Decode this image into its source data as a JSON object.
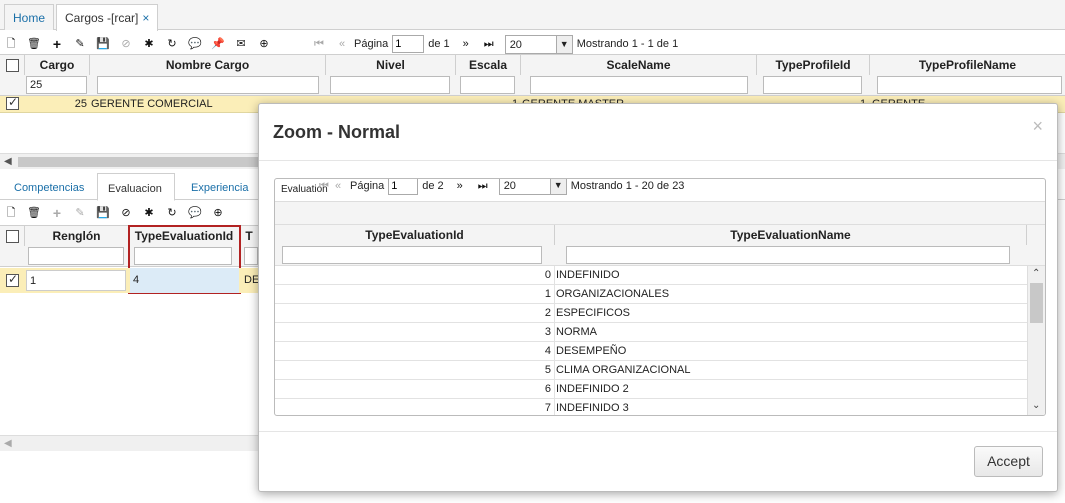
{
  "tabs": [
    {
      "label": "Home"
    },
    {
      "label": "Cargos -[rcar]",
      "close": "×"
    }
  ],
  "top_pager": {
    "page_label": "Página",
    "page_value": "1",
    "of_label": "de 1",
    "page_size": "20",
    "showing": "Mostrando 1 - 1 de 1"
  },
  "top_grid": {
    "columns": [
      "Cargo",
      "Nombre Cargo",
      "Nivel",
      "Escala",
      "ScaleName",
      "TypeProfileId",
      "TypeProfileName"
    ],
    "filter_cargo": "25",
    "row": {
      "cargo": "25",
      "nombre": "GERENTE COMERCIAL",
      "escala_partial": "1",
      "scale_partial": "GERENTE MASTER",
      "typeprofile_partial": "1",
      "typeprofilename_partial": "GERENTE"
    }
  },
  "detail_tabs": [
    "Competencias",
    "Evaluacion",
    "Experiencia"
  ],
  "bottom_grid": {
    "columns": [
      "Renglón",
      "TypeEvaluationId",
      "T"
    ],
    "row": {
      "renglon": "1",
      "type_eval_id": "4",
      "partial": "DE"
    }
  },
  "modal": {
    "title": "Zoom - Normal",
    "close": "×",
    "inner_tab": "Evaluation",
    "pager": {
      "page_label": "Página",
      "page_value": "1",
      "of_label": "de 2",
      "page_size": "20",
      "showing": "Mostrando 1 - 20 de 23"
    },
    "columns": [
      "TypeEvaluationId",
      "TypeEvaluationName"
    ],
    "rows": [
      {
        "id": "0",
        "name": "INDEFINIDO"
      },
      {
        "id": "1",
        "name": "ORGANIZACIONALES"
      },
      {
        "id": "2",
        "name": "ESPECIFICOS"
      },
      {
        "id": "3",
        "name": "NORMA"
      },
      {
        "id": "4",
        "name": "DESEMPEÑO"
      },
      {
        "id": "5",
        "name": "CLIMA ORGANIZACIONAL"
      },
      {
        "id": "6",
        "name": "INDEFINIDO 2"
      },
      {
        "id": "7",
        "name": "INDEFINIDO 3"
      }
    ],
    "accept_label": "Accept"
  },
  "colors": {
    "selected_row": "#fbeeb8",
    "link": "#1a6fa8",
    "highlight_cell": "#dcebf7",
    "highlight_border": "#b22222"
  }
}
